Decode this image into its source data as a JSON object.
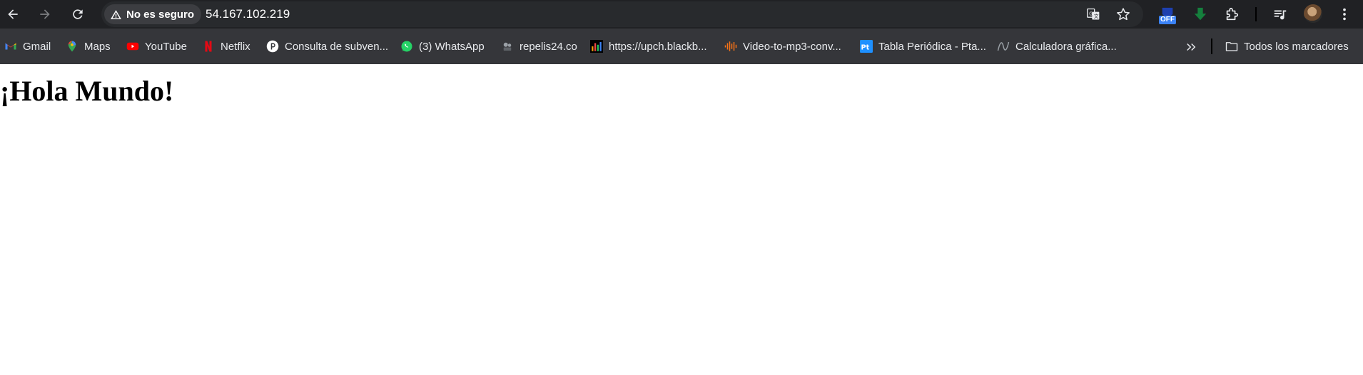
{
  "toolbar": {
    "security_label": "No es seguro",
    "url": "54.167.102.219"
  },
  "extensions": {
    "off_badge": "OFF"
  },
  "bookmarks": [
    {
      "label": "Gmail",
      "icon": "gmail-icon"
    },
    {
      "label": "Maps",
      "icon": "maps-icon"
    },
    {
      "label": "YouTube",
      "icon": "youtube-icon"
    },
    {
      "label": "Netflix",
      "icon": "netflix-icon"
    },
    {
      "label": "Consulta de subven...",
      "icon": "p-circle-icon"
    },
    {
      "label": "(3) WhatsApp",
      "icon": "whatsapp-icon"
    },
    {
      "label": "repelis24.co",
      "icon": "film-reel-icon"
    },
    {
      "label": "https://upch.blackb...",
      "icon": "bar-chart-icon"
    },
    {
      "label": "Video-to-mp3-conv...",
      "icon": "soundwave-icon"
    },
    {
      "label": "Tabla Periódica - Pta...",
      "icon": "pt-icon"
    },
    {
      "label": "Calculadora gráfica...",
      "icon": "graph-curve-icon"
    }
  ],
  "all_bookmarks_label": "Todos los marcadores",
  "page": {
    "heading": "¡Hola Mundo!"
  },
  "colors": {
    "toolbar_bg": "#202124",
    "omnibox_bg": "#282a2d",
    "bookmarks_bg": "#35363a",
    "page_bg": "#ffffff"
  }
}
